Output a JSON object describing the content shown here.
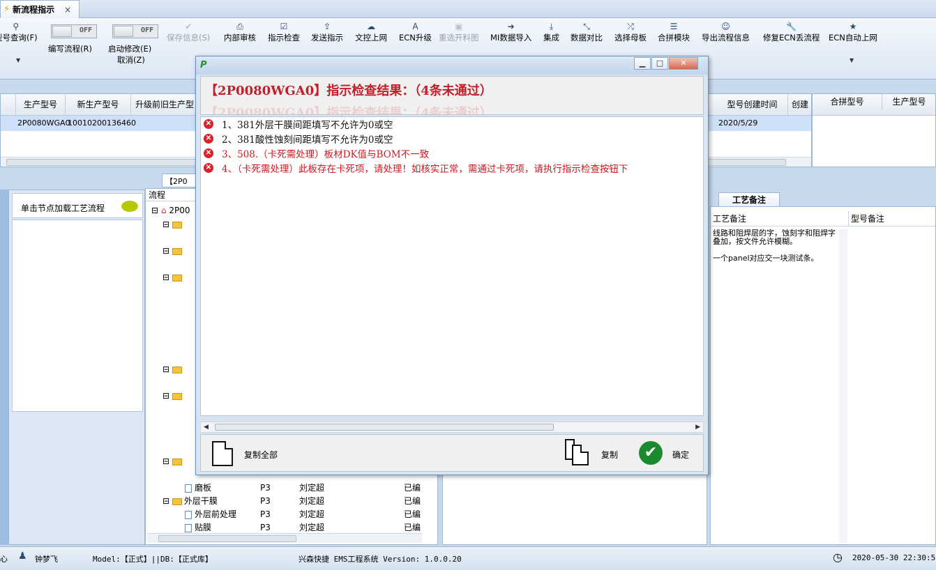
{
  "tab": {
    "title": "新流程指示",
    "close": "×"
  },
  "toolbar": {
    "toggles": [
      {
        "state": "OFF",
        "label": "编写流程(R)"
      },
      {
        "state": "OFF",
        "label": "启动修改(E)",
        "label2": "取消(Z)"
      }
    ],
    "buttons": [
      {
        "label": "型号查询(F)",
        "icon": "search-icon",
        "disabled": false
      },
      {
        "label": "保存信息(S)",
        "icon": "check-icon",
        "disabled": true
      },
      {
        "label": "内部审核",
        "icon": "printer-icon",
        "disabled": false
      },
      {
        "label": "指示检查",
        "icon": "checkbox-icon",
        "disabled": false
      },
      {
        "label": "发送指示",
        "icon": "upload-icon",
        "disabled": false
      },
      {
        "label": "文控上网",
        "icon": "cloud-upload-icon",
        "disabled": false
      },
      {
        "label": "ECN升级",
        "icon": "font-icon",
        "disabled": false
      },
      {
        "label": "重选开料图",
        "icon": "image-icon",
        "disabled": true
      },
      {
        "label": "MI数据导入",
        "icon": "signin-icon",
        "disabled": false
      },
      {
        "label": "集成",
        "icon": "download-icon",
        "disabled": false
      },
      {
        "label": "数据对比",
        "icon": "compress-icon",
        "disabled": false
      },
      {
        "label": "选择母板",
        "icon": "shuffle-icon",
        "disabled": false
      },
      {
        "label": "合拼模块",
        "icon": "list-icon",
        "disabled": false
      },
      {
        "label": "导出流程信息",
        "icon": "smile-icon",
        "disabled": false
      },
      {
        "label": "修复ECN丢流程",
        "icon": "wrench-icon",
        "disabled": false
      },
      {
        "label": "ECN自动上网",
        "icon": "star-icon",
        "disabled": false
      }
    ]
  },
  "grid": {
    "headers": [
      "生产型号",
      "新生产型号",
      "升级前旧生产型",
      "型号创建时间",
      "创建"
    ],
    "row": {
      "model": "2P0080WGA0",
      "new_model": "10010200136460",
      "created": "2020/5/29"
    },
    "right_headers": [
      "合拼型号",
      "生产型号"
    ]
  },
  "left_panel": {
    "hint": "单击节点加载工艺流程"
  },
  "tree": {
    "header": "流程",
    "root": "2P00",
    "mid_tab": "【2P0",
    "rows": [
      {
        "name": "磨板",
        "code": "P3",
        "person": "刘定超",
        "status": "已编"
      },
      {
        "name": "外层干膜",
        "code": "P3",
        "person": "刘定超",
        "status": "已编"
      },
      {
        "name": "外层前处理",
        "code": "P3",
        "person": "刘定超",
        "status": "已编"
      },
      {
        "name": "贴膜",
        "code": "P3",
        "person": "刘定超",
        "status": "已编"
      }
    ]
  },
  "notes": {
    "tab": "工艺备注",
    "col1": "工艺备注",
    "col2": "型号备注",
    "text1": "线路和阻焊层的字，蚀刻字和阻焊字叠加，按文件允许模糊。",
    "text2": "一个panel对应交一块测试条。"
  },
  "dialog": {
    "title": "【2P0080WGA0】指示检查结果：（4条未通过）",
    "ghost": "【2P0080WGA0】指示检查结果：（4条未通过）",
    "errors": [
      {
        "text": "1、381外层干膜间距填写不允许为0或空",
        "color": "black"
      },
      {
        "text": "2、381酸性蚀刻间距填写不允许为0或空",
        "color": "black"
      },
      {
        "text": "3、508.（卡死需处理）板材DK值与BOM不一致",
        "color": "red"
      },
      {
        "text": "4、（卡死需处理）此板存在卡死项，请处理！如核实正常，需通过卡死项，请执行指示检查按钮下",
        "color": "red"
      }
    ],
    "copy_all": "复制全部",
    "copy": "复制",
    "ok": "确定"
  },
  "status": {
    "left": "心",
    "user": "钟梦飞",
    "model": "Model:【正式】||DB:【正式库】",
    "app": "兴森快捷 EMS工程系统 Version: 1.0.0.20",
    "datetime": "2020-05-30 22:30:56"
  },
  "colors": {
    "accent": "#c0202a",
    "error": "#d0181f",
    "ok": "#1c8a2e"
  }
}
